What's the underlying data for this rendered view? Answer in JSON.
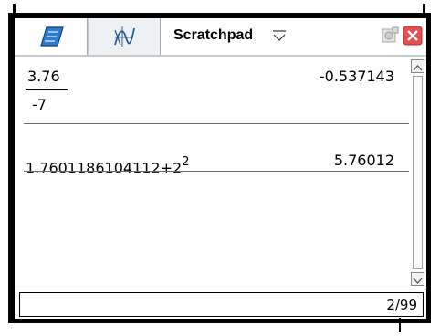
{
  "tabs": [
    {
      "icon": "calculator-icon"
    },
    {
      "icon": "graph-icon"
    },
    {
      "label": "Scratchpad"
    }
  ],
  "calculations": [
    {
      "numerator": "3.76",
      "denominator": "-7",
      "result": "-0.537143"
    },
    {
      "base": "1.7601186104112+2",
      "exponent": "2",
      "result": "5.76012"
    }
  ],
  "status": {
    "page_counter": "2/99"
  },
  "colors": {
    "close": "#e04040",
    "frame": "#000000",
    "calc_icon": "#1a5ea8",
    "graph_icon": "#3a6a9c"
  }
}
